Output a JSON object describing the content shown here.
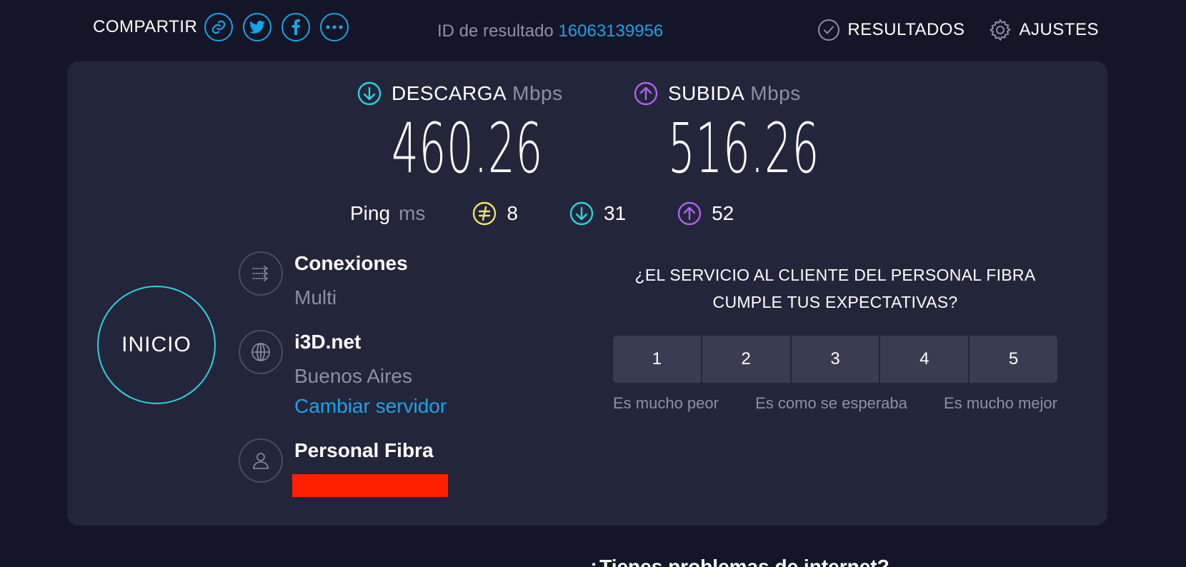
{
  "header": {
    "share_label": "COMPARTIR",
    "share_icons": [
      "link-icon",
      "twitter-icon",
      "facebook-icon",
      "more-icon"
    ],
    "result_id_label": "ID de resultado",
    "result_id_value": "16063139956",
    "results_label": "RESULTADOS",
    "settings_label": "AJUSTES"
  },
  "download": {
    "label": "DESCARGA",
    "unit": "Mbps",
    "value": "460.26"
  },
  "upload": {
    "label": "SUBIDA",
    "unit": "Mbps",
    "value": "516.26"
  },
  "ping": {
    "label": "Ping",
    "unit": "ms",
    "idle": "8",
    "download": "31",
    "upload": "52"
  },
  "start_button": "INICIO",
  "connections": {
    "title": "Conexiones",
    "value": "Multi"
  },
  "server": {
    "name": "i3D.net",
    "location": "Buenos Aires",
    "change_link": "Cambiar servidor"
  },
  "provider": {
    "name": "Personal Fibra"
  },
  "survey": {
    "question": "¿EL SERVICIO AL CLIENTE DEL PERSONAL FIBRA CUMPLE TUS EXPECTATIVAS?",
    "options": [
      "1",
      "2",
      "3",
      "4",
      "5"
    ],
    "scale_low": "Es mucho peor",
    "scale_mid": "Es como se esperaba",
    "scale_high": "Es mucho mejor"
  },
  "bottom_heading": "¿Tienes problemas de internet?",
  "colors": {
    "background": "#141526",
    "card": "#23253a",
    "accent_blue": "#1aa3e8",
    "download": "#2ad4e0",
    "upload": "#b061f0",
    "ping": "#f4e26b",
    "redaction": "#ff2000"
  }
}
